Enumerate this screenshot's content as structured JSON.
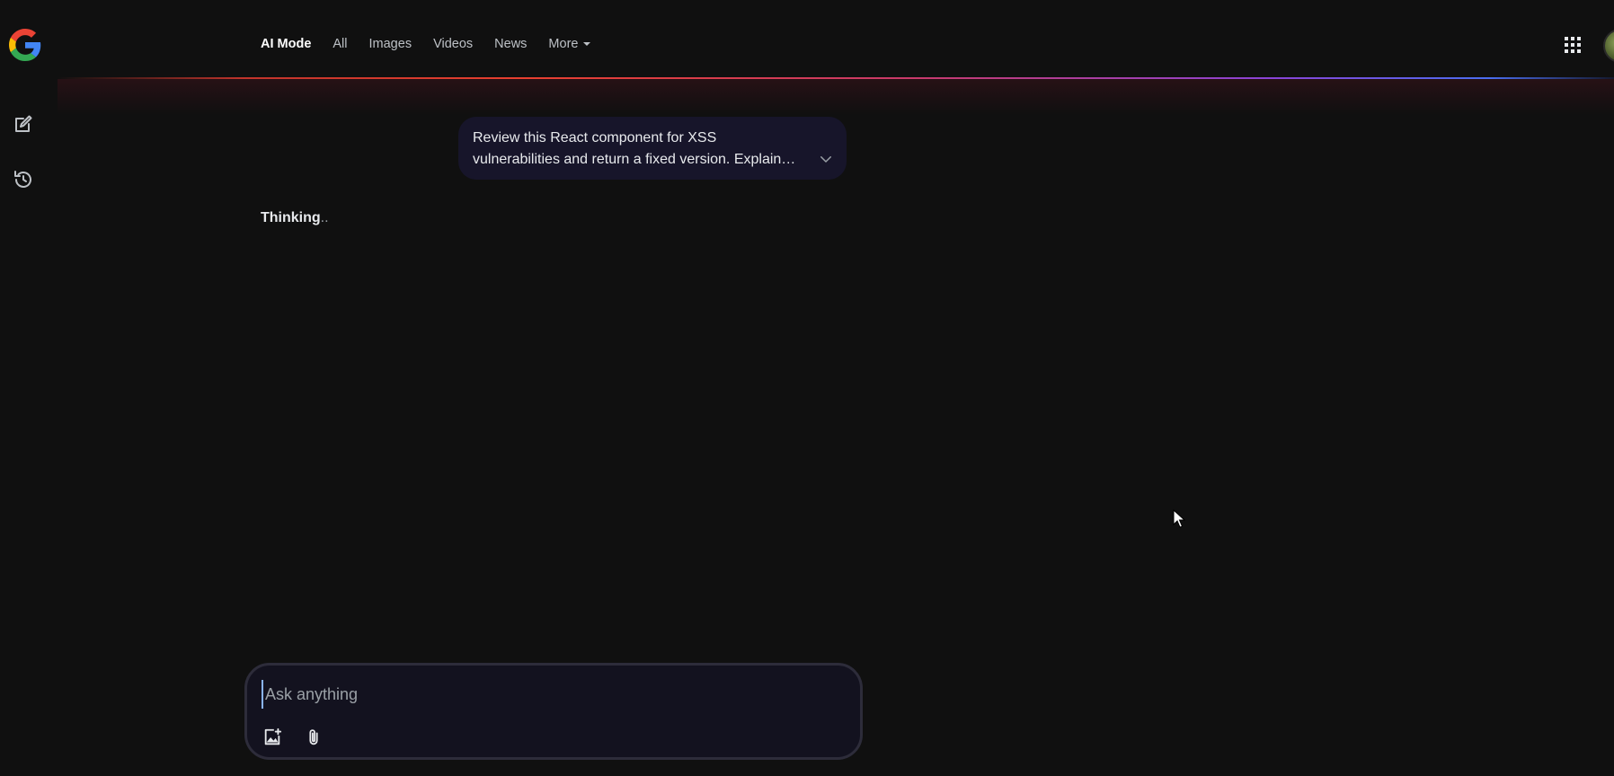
{
  "header": {
    "tabs": [
      {
        "label": "AI Mode",
        "active": true
      },
      {
        "label": "All"
      },
      {
        "label": "Images"
      },
      {
        "label": "Videos"
      },
      {
        "label": "News"
      },
      {
        "label": "More"
      }
    ]
  },
  "conversation": {
    "query": "Review this React component for XSS vulnerabilities and return a fixed version. Explain each change in detail.",
    "status_label": "Thinking",
    "status_dots": ".."
  },
  "ask": {
    "placeholder": "Ask anything"
  },
  "icons": {
    "logo": "google-g-logo",
    "new_chat": "edit-icon",
    "history": "history-icon",
    "apps": "apps-grid-icon",
    "expand": "chevron-down-icon",
    "image_upload": "add-image-icon",
    "attach": "paperclip-icon"
  },
  "colors": {
    "background": "#101010",
    "bubble": "#17152a",
    "ask_box": "#13121f",
    "ask_border": "#2d2c3a"
  }
}
